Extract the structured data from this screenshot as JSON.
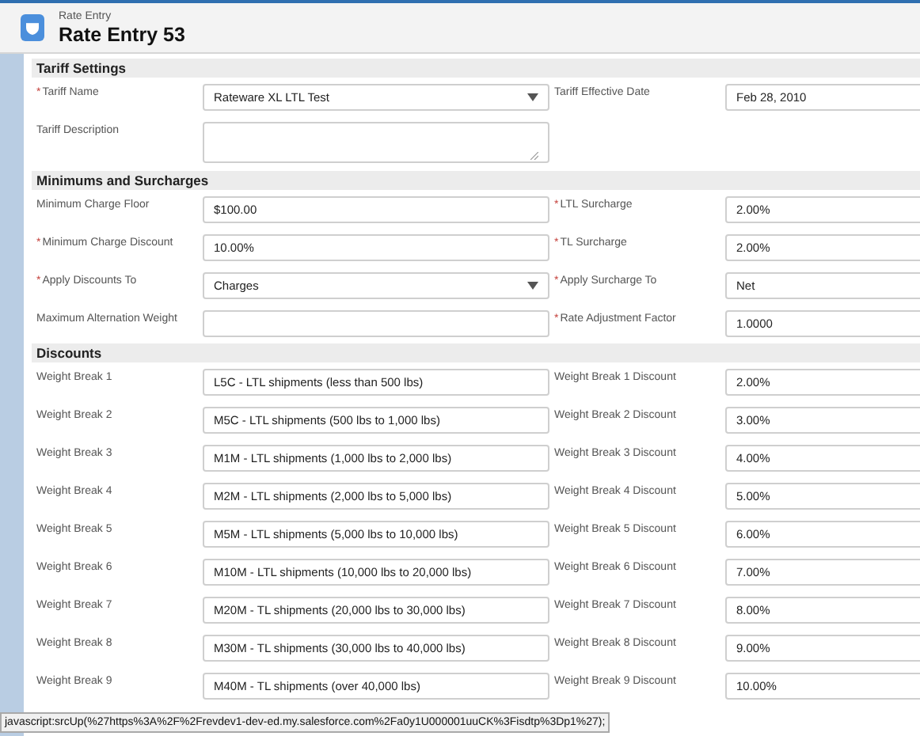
{
  "header": {
    "object_type": "Rate Entry",
    "title": "Rate Entry 53"
  },
  "sections": [
    {
      "title": "Tariff Settings",
      "rows": [
        {
          "left": {
            "label": "Tariff Name",
            "required_mark": "*",
            "kind": "select",
            "value": "Rateware XL LTL Test"
          },
          "right": {
            "label": "Tariff Effective Date",
            "kind": "text",
            "value": "Feb 28, 2010"
          }
        },
        {
          "left": {
            "label": "Tariff Description",
            "kind": "textarea"
          }
        }
      ]
    },
    {
      "title": "Minimums and Surcharges",
      "rows": [
        {
          "left": {
            "label": "Minimum Charge Floor",
            "kind": "text",
            "value": "$100.00"
          },
          "right": {
            "label": "LTL Surcharge",
            "required_mark": "*",
            "kind": "text",
            "value": "2.00%"
          }
        },
        {
          "left": {
            "label": "Minimum Charge Discount",
            "required_mark": "*",
            "kind": "text",
            "value": "10.00%"
          },
          "right": {
            "label": "TL Surcharge",
            "required_mark": "*",
            "kind": "text",
            "value": "2.00%"
          }
        },
        {
          "left": {
            "label": "Apply Discounts To",
            "required_mark": "*",
            "kind": "select",
            "value": "Charges"
          },
          "right": {
            "label": "Apply Surcharge To",
            "required_mark": "*",
            "kind": "text",
            "value": "Net"
          }
        },
        {
          "left": {
            "label": "Maximum Alternation Weight",
            "kind": "text"
          },
          "right": {
            "label": "Rate Adjustment Factor",
            "required_mark": "*",
            "kind": "text",
            "value": "1.0000"
          }
        }
      ]
    },
    {
      "title": "Discounts",
      "rows": [
        {
          "left": {
            "label": "Weight Break 1",
            "kind": "text",
            "value": "L5C - LTL shipments (less than 500 lbs)"
          },
          "right": {
            "label": "Weight Break 1 Discount",
            "kind": "text",
            "value": "2.00%"
          }
        },
        {
          "left": {
            "label": "Weight Break 2",
            "kind": "text",
            "value": "M5C - LTL shipments (500 lbs to 1,000 lbs)"
          },
          "right": {
            "label": "Weight Break 2 Discount",
            "kind": "text",
            "value": "3.00%"
          }
        },
        {
          "left": {
            "label": "Weight Break 3",
            "kind": "text",
            "value": "M1M - LTL shipments (1,000 lbs to 2,000 lbs)"
          },
          "right": {
            "label": "Weight Break 3 Discount",
            "kind": "text",
            "value": "4.00%"
          }
        },
        {
          "left": {
            "label": "Weight Break 4",
            "kind": "text",
            "value": "M2M - LTL shipments (2,000 lbs to 5,000 lbs)"
          },
          "right": {
            "label": "Weight Break 4 Discount",
            "kind": "text",
            "value": "5.00%"
          }
        },
        {
          "left": {
            "label": "Weight Break 5",
            "kind": "text",
            "value": "M5M - LTL shipments (5,000 lbs to 10,000 lbs)"
          },
          "right": {
            "label": "Weight Break 5 Discount",
            "kind": "text",
            "value": "6.00%"
          }
        },
        {
          "left": {
            "label": "Weight Break 6",
            "kind": "text",
            "value": "M10M - LTL shipments (10,000 lbs to 20,000 lbs)"
          },
          "right": {
            "label": "Weight Break 6 Discount",
            "kind": "text",
            "value": "7.00%"
          }
        },
        {
          "left": {
            "label": "Weight Break 7",
            "kind": "text",
            "value": "M20M - TL shipments (20,000 lbs to 30,000 lbs)"
          },
          "right": {
            "label": "Weight Break 7 Discount",
            "kind": "text",
            "value": "8.00%"
          }
        },
        {
          "left": {
            "label": "Weight Break 8",
            "kind": "text",
            "value": "M30M - TL shipments (30,000 lbs to 40,000 lbs)"
          },
          "right": {
            "label": "Weight Break 8 Discount",
            "kind": "text",
            "value": "9.00%"
          }
        },
        {
          "left": {
            "label": "Weight Break 9",
            "kind": "text",
            "value": "M40M - TL shipments (over 40,000 lbs)"
          },
          "right": {
            "label": "Weight Break 9 Discount",
            "kind": "text",
            "value": "10.00%"
          }
        }
      ]
    }
  ],
  "status_bar": {
    "text": "javascript:srcUp(%27https%3A%2F%2Frevdev1-dev-ed.my.salesforce.com%2Fa0y1U000001uuCK%3Fisdtp%3Dp1%27);"
  }
}
